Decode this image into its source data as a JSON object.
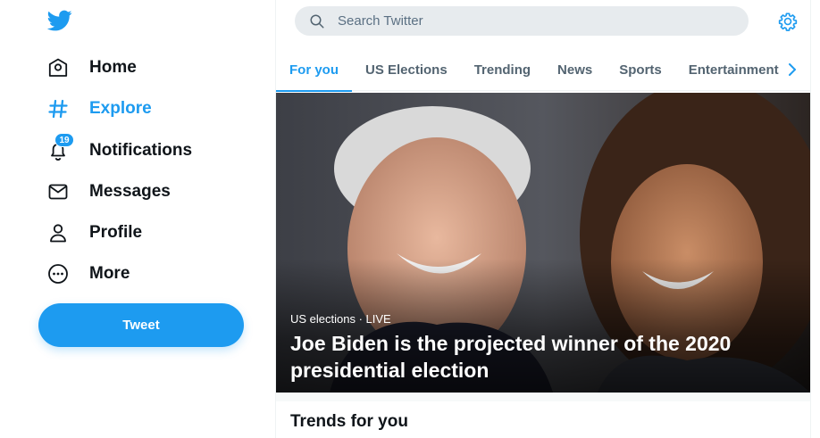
{
  "sidebar": {
    "logo": "twitter-bird-icon",
    "items": [
      {
        "label": "Home",
        "icon": "home-icon",
        "active": false
      },
      {
        "label": "Explore",
        "icon": "hashtag-icon",
        "active": true
      },
      {
        "label": "Notifications",
        "icon": "bell-icon",
        "active": false,
        "badge": "19"
      },
      {
        "label": "Messages",
        "icon": "envelope-icon",
        "active": false
      },
      {
        "label": "Profile",
        "icon": "person-icon",
        "active": false
      },
      {
        "label": "More",
        "icon": "more-circle-icon",
        "active": false
      }
    ],
    "tweet_label": "Tweet"
  },
  "header": {
    "search_placeholder": "Search Twitter",
    "settings_icon": "gear-icon"
  },
  "tabs": [
    {
      "label": "For you",
      "active": true
    },
    {
      "label": "US Elections",
      "active": false
    },
    {
      "label": "Trending",
      "active": false
    },
    {
      "label": "News",
      "active": false
    },
    {
      "label": "Sports",
      "active": false
    },
    {
      "label": "Entertainment",
      "active": false
    }
  ],
  "hero": {
    "category": "US elections",
    "status": "LIVE",
    "meta": "US elections · LIVE",
    "headline": "Joe Biden is the projected winner of the 2020 presidential election"
  },
  "trends": {
    "title": "Trends for you"
  },
  "colors": {
    "accent": "#1d9bf0",
    "text": "#0f1419",
    "muted": "#536471",
    "search_bg": "#e7ebee"
  }
}
